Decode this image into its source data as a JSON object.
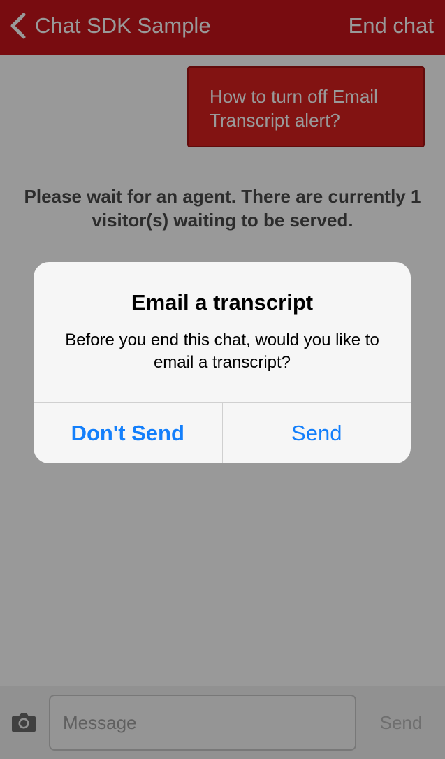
{
  "navbar": {
    "back_label": "Chat SDK Sample",
    "end_label": "End chat",
    "color": "#c8151b"
  },
  "chat": {
    "user_message": "How to turn off Email Transcript alert?",
    "system_message": "Please wait for an agent. There are currently 1 visitor(s) waiting to be served."
  },
  "input_bar": {
    "placeholder": "Message",
    "send_label": "Send",
    "camera_icon": "camera-icon"
  },
  "alert": {
    "title": "Email a transcript",
    "message": "Before you end this chat, would you like to email a transcript?",
    "dont_send_label": "Don't Send",
    "send_label": "Send",
    "button_color": "#137ffb"
  }
}
